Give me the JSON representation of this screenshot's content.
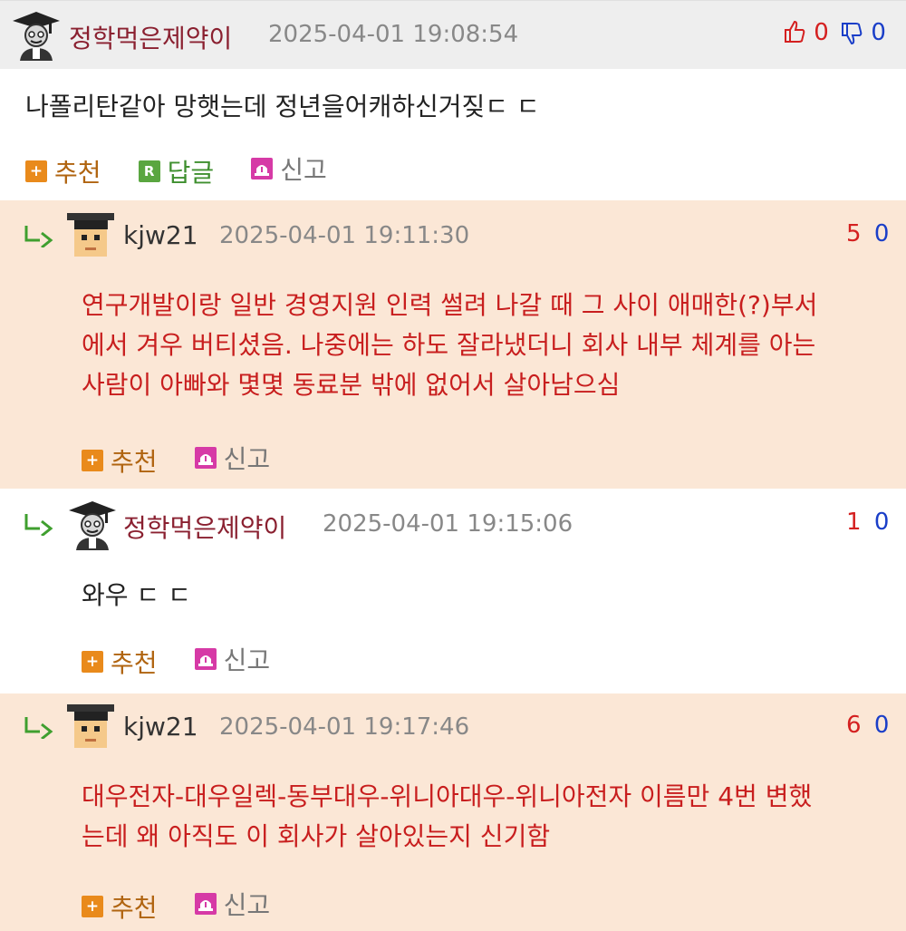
{
  "comments": {
    "main": {
      "user": "정학먹은제약이",
      "time": "2025-04-01 19:08:54",
      "up": "0",
      "down": "0",
      "text": "나폴리탄같아 망햇는데 정년을어캐하신거짖ㄷ ㄷ",
      "actions": {
        "recommend": "추천",
        "reply": "답글",
        "report": "신고"
      }
    },
    "replies": [
      {
        "user": "kjw21",
        "time": "2025-04-01 19:11:30",
        "up": "5",
        "down": "0",
        "lines": [
          "연구개발이랑 일반 경영지원 인력 썰려 나갈 때 그 사이 애매한(?)부서",
          "에서 겨우 버티셨음. 나중에는 하도 잘라냈더니 회사 내부 체계를 아는",
          "사람이 아빠와 몇몇 동료분 밖에 없어서 살아남으심"
        ],
        "actions": {
          "recommend": "추천",
          "report": "신고"
        }
      },
      {
        "user": "정학먹은제약이",
        "time": "2025-04-01 19:15:06",
        "up": "1",
        "down": "0",
        "lines": [
          "와우 ㄷ ㄷ"
        ],
        "actions": {
          "recommend": "추천",
          "report": "신고"
        }
      },
      {
        "user": "kjw21",
        "time": "2025-04-01 19:17:46",
        "up": "6",
        "down": "0",
        "lines": [
          "대우전자-대우일렉-동부대우-위니아대우-위니아전자 이름만 4번 변했",
          "는데 왜 아직도 이 회사가 살아있는지 신기함"
        ],
        "actions": {
          "recommend": "추천",
          "report": "신고"
        }
      }
    ]
  },
  "icons": {
    "avatar_main": "graduate-avatar-icon",
    "avatar_kjw": "pixel-student-avatar-icon",
    "reply_arrow": "reply-arrow-icon",
    "thumbs_up": "thumbs-up-icon",
    "thumbs_down": "thumbs-down-icon",
    "recommend": "plus-icon",
    "reply": "reply-r-icon",
    "report": "siren-icon"
  },
  "colors": {
    "username": "#8a2030",
    "reply_text": "#c81e1e",
    "peach_bg": "#fbe7d6",
    "header_bg": "#eeeeee",
    "up": "#d42020",
    "down": "#1a3ec8"
  }
}
